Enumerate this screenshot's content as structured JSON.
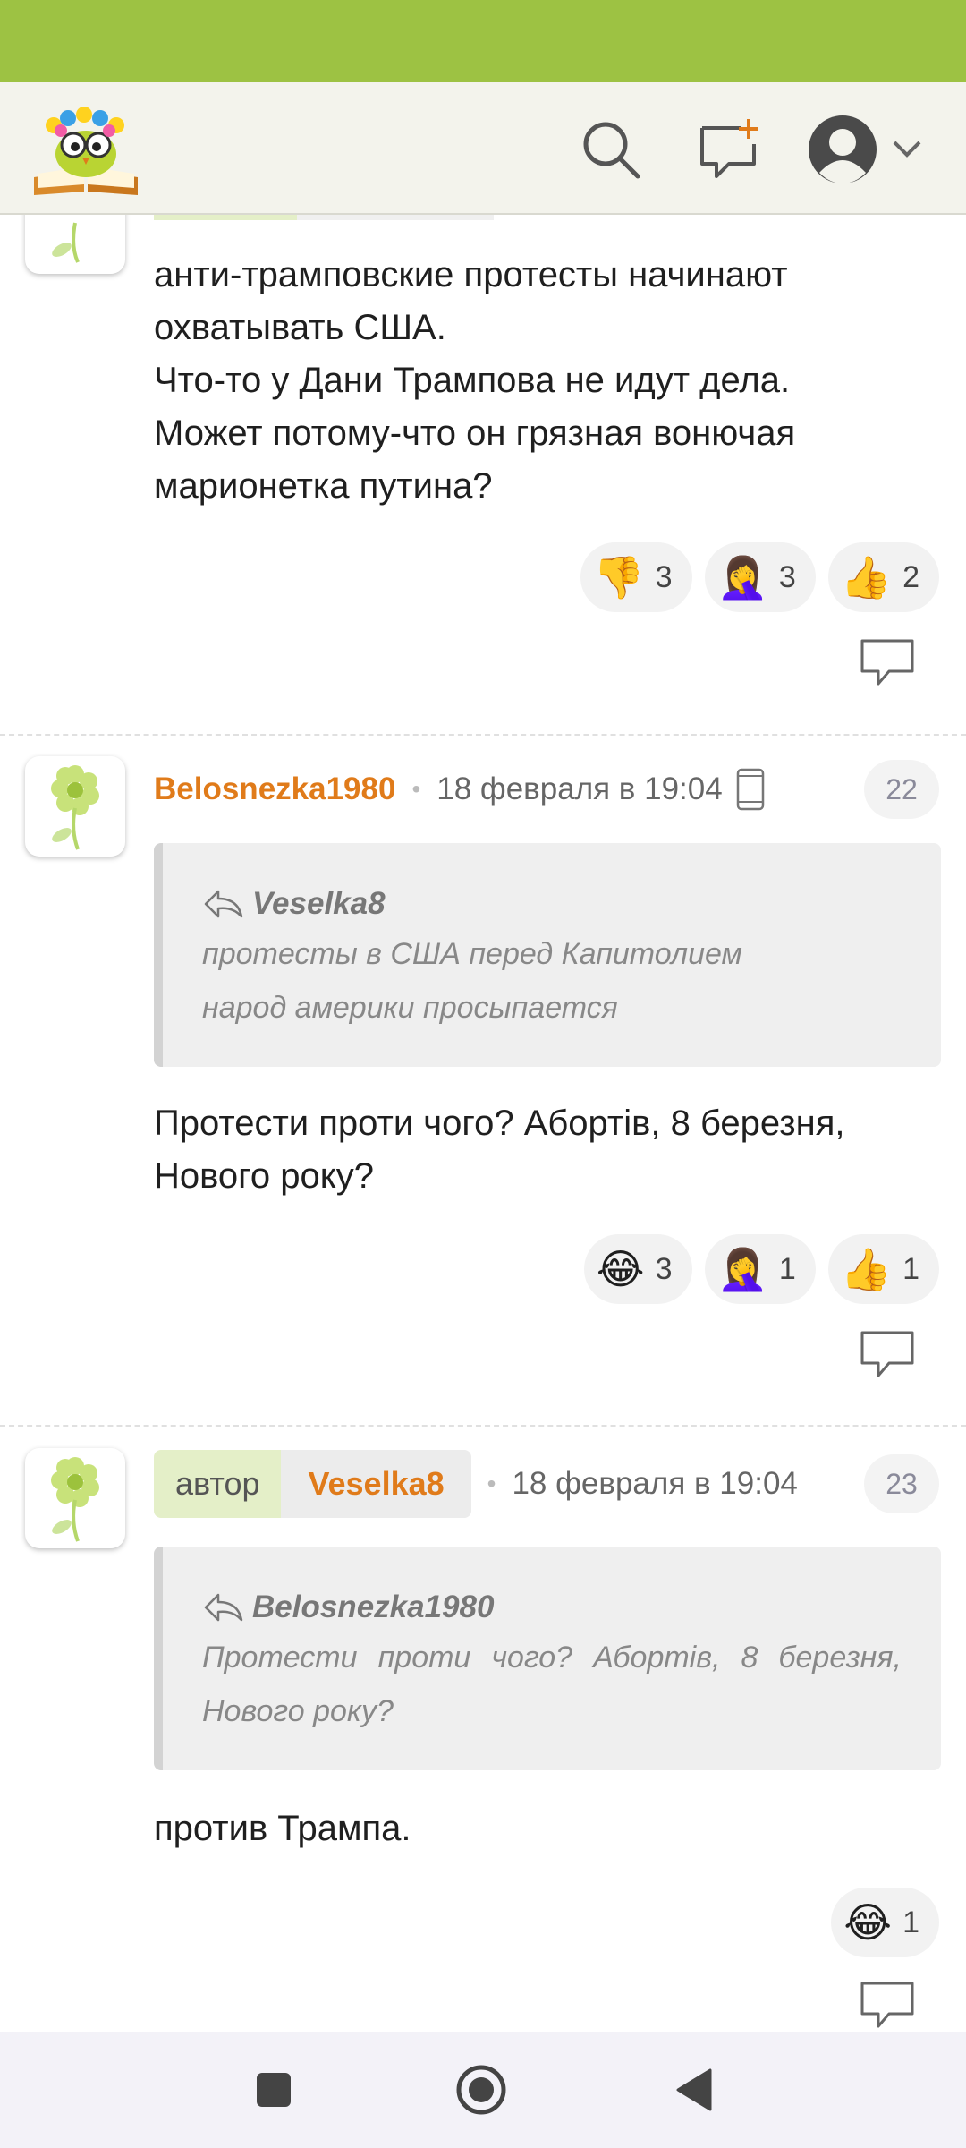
{
  "colors": {
    "status_bar": "#9dc243",
    "username": "#e07b1a",
    "author_tag": "#e4efc8"
  },
  "header": {
    "logo_icon": "owl-book-logo-icon",
    "search_icon": "search-icon",
    "compose_icon": "new-message-icon",
    "user_icon": "user-avatar-icon",
    "dropdown_icon": "chevron-down-icon"
  },
  "comments": [
    {
      "text_lines": [
        "анти-трамповские протесты начинают",
        "охватывать США.",
        "Что-то у Дани Трампова не идут дела.",
        "Может потому-что он грязная вонючая",
        "марионетка путина?"
      ],
      "reactions": [
        {
          "emoji": "👎",
          "count": "3"
        },
        {
          "emoji": "🤦‍♀️",
          "count": "3"
        },
        {
          "emoji": "👍",
          "count": "2"
        }
      ]
    },
    {
      "username": "Belosnezka1980",
      "timestamp": "18 февраля в 19:04",
      "number": "22",
      "quote": {
        "author": "Veselka8",
        "lines": [
          "протесты в США перед Капитолием",
          "народ америки просыпается"
        ]
      },
      "text_lines": [
        "Протести проти чого? Абортів, 8 березня,",
        "Нового року?"
      ],
      "reactions": [
        {
          "emoji": "😂",
          "count": "3"
        },
        {
          "emoji": "🤦‍♀️",
          "count": "1"
        },
        {
          "emoji": "👍",
          "count": "1"
        }
      ]
    },
    {
      "author_tag": "автор",
      "username": "Veselka8",
      "timestamp": "18 февраля в 19:04",
      "number": "23",
      "quote": {
        "author": "Belosnezka1980",
        "lines": [
          "Протести проти чого? Абортів, 8 березня,",
          "Нового року?"
        ]
      },
      "text_lines": [
        "против Трампа."
      ],
      "reactions": [
        {
          "emoji": "😂",
          "count": "1"
        }
      ]
    }
  ],
  "nav": {
    "recents_icon": "recents-square-icon",
    "home_icon": "home-circle-icon",
    "back_icon": "back-triangle-icon"
  }
}
